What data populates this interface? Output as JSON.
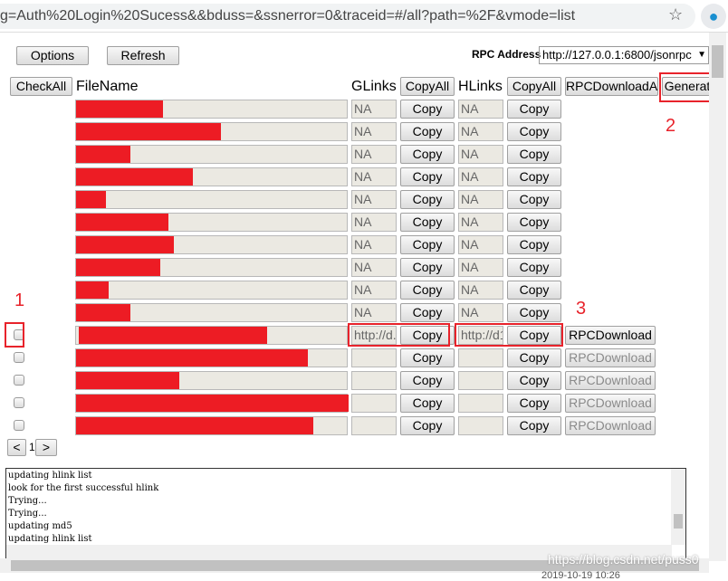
{
  "browser": {
    "url": "g=Auth%20Login%20Sucess&&bduss=&ssnerror=0&traceid=#/all?path=%2F&vmode=list",
    "star_icon": "star-icon",
    "extension_icon": "lightbulb-icon"
  },
  "toolbar": {
    "options": "Options",
    "refresh": "Refresh",
    "rpc_label": "RPC Address",
    "rpc_value": "http://127.0.0.1:6800/jsonrpc",
    "rpc_arrow": "▼"
  },
  "header": {
    "checkall": "CheckAll",
    "filename": "FileName",
    "glinks": "GLinks",
    "copyall_g": "CopyAll",
    "hlinks": "HLinks",
    "copyall_h": "CopyAll",
    "rpcall": "RPCDownloadA",
    "generate": "Generat"
  },
  "copy_label": "Copy",
  "rpc_label": "RPCDownload",
  "rows": [
    {
      "checkbox": false,
      "redacted": 0.32,
      "glink": "NA",
      "hlink": "NA",
      "rpc": null
    },
    {
      "checkbox": false,
      "redacted": 0.53,
      "glink": "NA",
      "hlink": "NA",
      "rpc": null
    },
    {
      "checkbox": false,
      "redacted": 0.2,
      "glink": "NA",
      "hlink": "NA",
      "rpc": null
    },
    {
      "checkbox": false,
      "redacted": 0.43,
      "glink": "NA",
      "hlink": "NA",
      "rpc": null
    },
    {
      "checkbox": false,
      "redacted": 0.11,
      "glink": "NA",
      "hlink": "NA",
      "rpc": null
    },
    {
      "checkbox": false,
      "redacted": 0.34,
      "glink": "NA",
      "hlink": "NA",
      "rpc": null
    },
    {
      "checkbox": false,
      "redacted": 0.36,
      "glink": "NA",
      "hlink": "NA",
      "rpc": null
    },
    {
      "checkbox": false,
      "redacted": 0.31,
      "glink": "NA",
      "hlink": "NA",
      "rpc": null
    },
    {
      "checkbox": false,
      "redacted": 0.12,
      "glink": "NA",
      "hlink": "NA",
      "rpc": null
    },
    {
      "checkbox": false,
      "redacted": 0.2,
      "glink": "NA",
      "hlink": "NA",
      "rpc": null
    },
    {
      "checkbox": true,
      "redacted": 0.69,
      "glink": "http://d.p",
      "hlink": "http://d1",
      "rpc": "enabled"
    },
    {
      "checkbox": true,
      "redacted": 0.85,
      "glink": "",
      "hlink": "",
      "rpc": "disabled"
    },
    {
      "checkbox": true,
      "redacted": 0.38,
      "glink": "",
      "hlink": "",
      "rpc": "disabled"
    },
    {
      "checkbox": true,
      "redacted": 1.0,
      "glink": "",
      "hlink": "",
      "rpc": "disabled"
    },
    {
      "checkbox": true,
      "redacted": 0.87,
      "glink": "",
      "hlink": "",
      "rpc": "disabled"
    }
  ],
  "pager": {
    "prev": "<",
    "page": "1",
    "next": ">"
  },
  "annotations": {
    "a1": "1",
    "a2": "2",
    "a3": "3"
  },
  "log": [
    "updating hlink list",
    "look for the first successful hlink",
    "Trying...",
    "Trying...",
    "updating md5",
    "updating hlink list"
  ],
  "watermark": "https://blog.csdn.net/puss0",
  "footer": "2019-10-19 10:26",
  "colors": {
    "redaction": "#ed1c24",
    "annotation": "#e8232b"
  }
}
